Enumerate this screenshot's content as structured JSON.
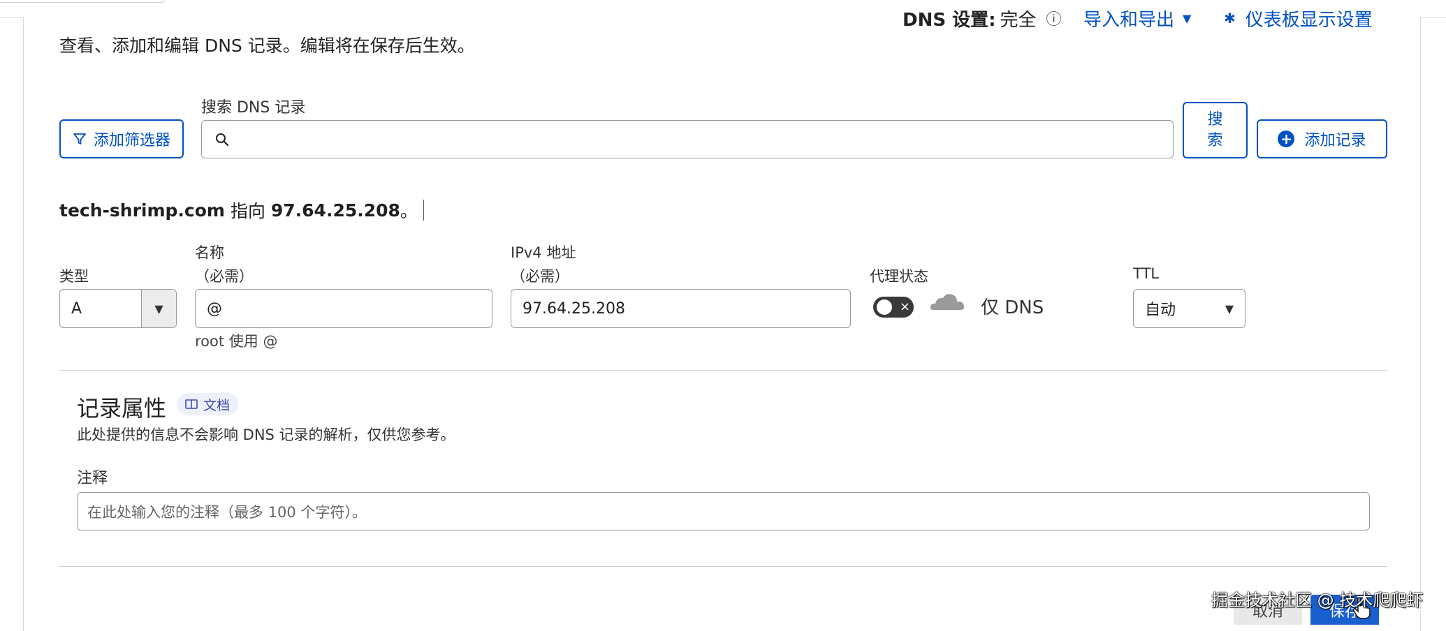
{
  "header": {
    "dns_setting_label": "DNS 设置:",
    "dns_setting_value": "完全",
    "import_export": "导入和导出",
    "dashboard_settings": "仪表板显示设置",
    "description": "查看、添加和编辑 DNS 记录。编辑将在保存后生效。"
  },
  "toolbar": {
    "filter_button": "添加筛选器",
    "search_label": "搜索 DNS 记录",
    "search_value": "",
    "search_button_line1": "搜",
    "search_button_line2": "索",
    "add_record_button": "添加记录"
  },
  "points_to": {
    "domain": "tech-shrimp.com",
    "middle": " 指向 ",
    "ip": "97.64.25.208",
    "end": "。"
  },
  "record_form": {
    "type_label": "类型",
    "type_value": "A",
    "name_label": "名称",
    "name_required": "（必需）",
    "name_value": "@",
    "name_helper": "root 使用 @",
    "ipv4_label": "IPv4 地址",
    "ipv4_required": "（必需）",
    "ipv4_value": "97.64.25.208",
    "proxy_label": "代理状态",
    "proxy_state": "仅 DNS",
    "ttl_label": "TTL",
    "ttl_value": "自动"
  },
  "attributes": {
    "title": "记录属性",
    "doc_badge": "文档",
    "description": "此处提供的信息不会影响 DNS 记录的解析，仅供您参考。",
    "note_label": "注释",
    "note_placeholder": "在此处输入您的注释（最多 100 个字符）。"
  },
  "footer": {
    "cancel": "取消",
    "save": "保存"
  },
  "watermark": "掘金技术社区 @ 技术爬爬虾",
  "colors": {
    "accent": "#0051c3",
    "save_bg": "#1a5fd0",
    "toggle_off": "#3a3a3a",
    "badge_bg": "#eef0fb"
  }
}
